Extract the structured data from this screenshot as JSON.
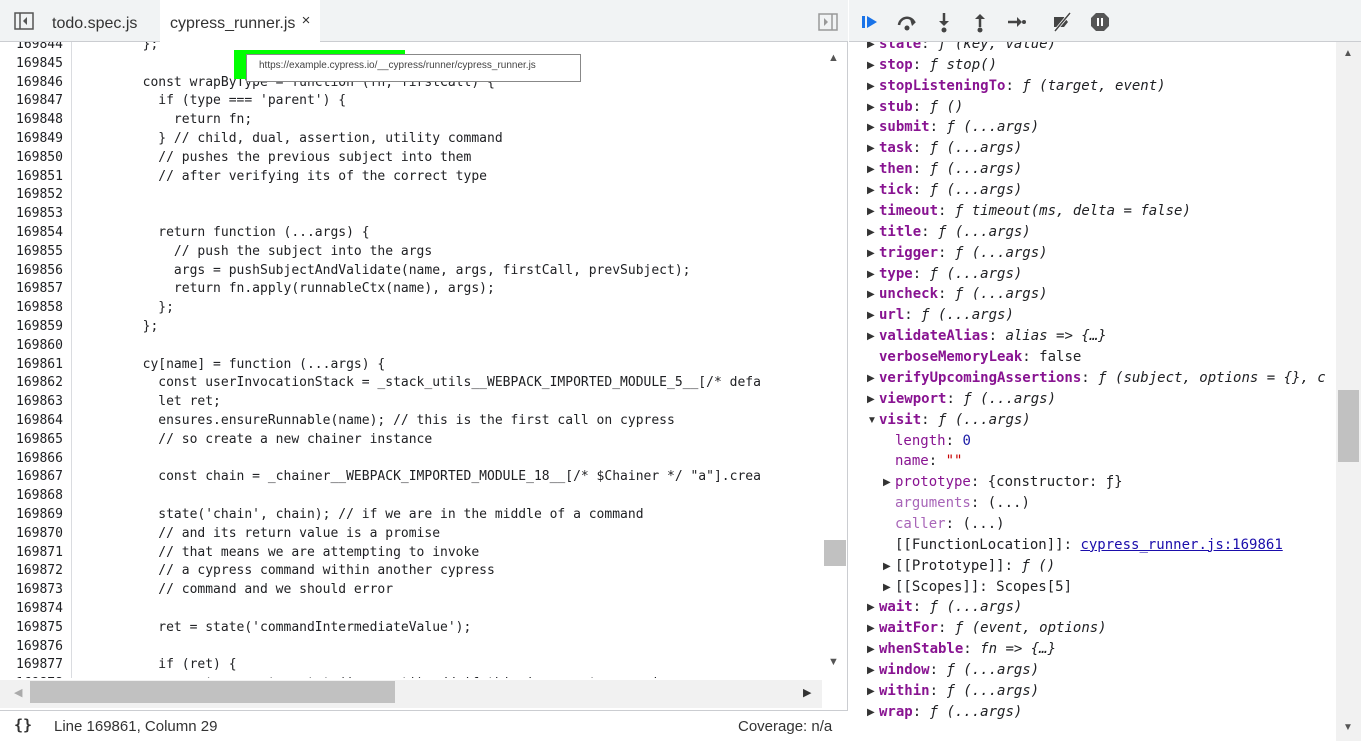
{
  "tabs": [
    {
      "label": "todo.spec.js"
    },
    {
      "label": "cypress_runner.js",
      "close": "×"
    }
  ],
  "tooltip": {
    "url": "https://example.cypress.io/__cypress/runner/cypress_runner.js"
  },
  "code_lines": [
    {
      "n": "169844",
      "t": "        };"
    },
    {
      "n": "169845",
      "t": ""
    },
    {
      "n": "169846",
      "t": "        const wrapByType = function (fn, firstCall) {"
    },
    {
      "n": "169847",
      "t": "          if (type === 'parent') {"
    },
    {
      "n": "169848",
      "t": "            return fn;"
    },
    {
      "n": "169849",
      "t": "          } // child, dual, assertion, utility command"
    },
    {
      "n": "169850",
      "t": "          // pushes the previous subject into them"
    },
    {
      "n": "169851",
      "t": "          // after verifying its of the correct type"
    },
    {
      "n": "169852",
      "t": ""
    },
    {
      "n": "169853",
      "t": ""
    },
    {
      "n": "169854",
      "t": "          return function (...args) {"
    },
    {
      "n": "169855",
      "t": "            // push the subject into the args"
    },
    {
      "n": "169856",
      "t": "            args = pushSubjectAndValidate(name, args, firstCall, prevSubject);"
    },
    {
      "n": "169857",
      "t": "            return fn.apply(runnableCtx(name), args);"
    },
    {
      "n": "169858",
      "t": "          };"
    },
    {
      "n": "169859",
      "t": "        };"
    },
    {
      "n": "169860",
      "t": ""
    },
    {
      "n": "169861",
      "t": "        cy[name] = function (...args) {"
    },
    {
      "n": "169862",
      "t": "          const userInvocationStack = _stack_utils__WEBPACK_IMPORTED_MODULE_5__[/* defa"
    },
    {
      "n": "169863",
      "t": "          let ret;"
    },
    {
      "n": "169864",
      "t": "          ensures.ensureRunnable(name); // this is the first call on cypress"
    },
    {
      "n": "169865",
      "t": "          // so create a new chainer instance"
    },
    {
      "n": "169866",
      "t": ""
    },
    {
      "n": "169867",
      "t": "          const chain = _chainer__WEBPACK_IMPORTED_MODULE_18__[/* $Chainer */ \"a\"].crea"
    },
    {
      "n": "169868",
      "t": ""
    },
    {
      "n": "169869",
      "t": "          state('chain', chain); // if we are in the middle of a command"
    },
    {
      "n": "169870",
      "t": "          // and its return value is a promise"
    },
    {
      "n": "169871",
      "t": "          // that means we are attempting to invoke"
    },
    {
      "n": "169872",
      "t": "          // a cypress command within another cypress"
    },
    {
      "n": "169873",
      "t": "          // command and we should error"
    },
    {
      "n": "169874",
      "t": ""
    },
    {
      "n": "169875",
      "t": "          ret = state('commandIntermediateValue');"
    },
    {
      "n": "169876",
      "t": ""
    },
    {
      "n": "169877",
      "t": "          if (ret) {"
    },
    {
      "n": "169878",
      "t": "            const current = state('current'); // if this is a custom promise"
    }
  ],
  "status": {
    "braces": "{}",
    "position": "Line 169861, Column 29",
    "coverage": "Coverage: n/a"
  },
  "scope": [
    {
      "arrow": "▶",
      "indent": 0,
      "key": "state",
      "colon": ":",
      "val": " ƒ (key, value)"
    },
    {
      "arrow": "▶",
      "indent": 0,
      "key": "stop",
      "colon": ":",
      "val": " ƒ stop()"
    },
    {
      "arrow": "▶",
      "indent": 0,
      "key": "stopListeningTo",
      "colon": ":",
      "val": " ƒ (target, event)"
    },
    {
      "arrow": "▶",
      "indent": 0,
      "key": "stub",
      "colon": ":",
      "val": " ƒ ()"
    },
    {
      "arrow": "▶",
      "indent": 0,
      "key": "submit",
      "colon": ":",
      "val": " ƒ (...args)"
    },
    {
      "arrow": "▶",
      "indent": 0,
      "key": "task",
      "colon": ":",
      "val": " ƒ (...args)"
    },
    {
      "arrow": "▶",
      "indent": 0,
      "key": "then",
      "colon": ":",
      "val": " ƒ (...args)"
    },
    {
      "arrow": "▶",
      "indent": 0,
      "key": "tick",
      "colon": ":",
      "val": " ƒ (...args)"
    },
    {
      "arrow": "▶",
      "indent": 0,
      "key": "timeout",
      "colon": ":",
      "val": " ƒ timeout(ms, delta = false)"
    },
    {
      "arrow": "▶",
      "indent": 0,
      "key": "title",
      "colon": ":",
      "val": " ƒ (...args)"
    },
    {
      "arrow": "▶",
      "indent": 0,
      "key": "trigger",
      "colon": ":",
      "val": " ƒ (...args)"
    },
    {
      "arrow": "▶",
      "indent": 0,
      "key": "type",
      "colon": ":",
      "val": " ƒ (...args)"
    },
    {
      "arrow": "▶",
      "indent": 0,
      "key": "uncheck",
      "colon": ":",
      "val": " ƒ (...args)"
    },
    {
      "arrow": "▶",
      "indent": 0,
      "key": "url",
      "colon": ":",
      "val": " ƒ (...args)"
    },
    {
      "arrow": "▶",
      "indent": 0,
      "key": "validateAlias",
      "colon": ":",
      "val": " alias => {…}"
    },
    {
      "arrow": "",
      "indent": 0,
      "key": "verboseMemoryLeak",
      "colon": ":",
      "val": " false"
    },
    {
      "arrow": "▶",
      "indent": 0,
      "key": "verifyUpcomingAssertions",
      "colon": ":",
      "val": " ƒ (subject, options = {}, c"
    },
    {
      "arrow": "▶",
      "indent": 0,
      "key": "viewport",
      "colon": ":",
      "val": " ƒ (...args)"
    },
    {
      "arrow": "▼",
      "indent": 0,
      "key": "visit",
      "colon": ":",
      "val": " ƒ (...args)"
    },
    {
      "arrow": "",
      "indent": 1,
      "key": "length",
      "colon": ":",
      "val": " 0",
      "valtype": "num",
      "keytype": "plain"
    },
    {
      "arrow": "",
      "indent": 1,
      "key": "name",
      "colon": ":",
      "val": " \"\"",
      "valtype": "str",
      "keytype": "plain"
    },
    {
      "arrow": "▶",
      "indent": 1,
      "key": "prototype",
      "colon": ":",
      "val": " {constructor: ƒ}",
      "keytype": "plain"
    },
    {
      "arrow": "",
      "indent": 1,
      "key": "arguments",
      "colon": ":",
      "val": " (...)",
      "keytype": "dim"
    },
    {
      "arrow": "",
      "indent": 1,
      "key": "caller",
      "colon": ":",
      "val": " (...)",
      "keytype": "dim"
    },
    {
      "arrow": "",
      "indent": 1,
      "key": "[[FunctionLocation]]",
      "colon": ":",
      "val": "cypress_runner.js:169861",
      "valtype": "link",
      "keytype": "internal"
    },
    {
      "arrow": "▶",
      "indent": 1,
      "key": "[[Prototype]]",
      "colon": ":",
      "val": " ƒ ()",
      "keytype": "internal"
    },
    {
      "arrow": "▶",
      "indent": 1,
      "key": "[[Scopes]]",
      "colon": ":",
      "val": " Scopes[5]",
      "keytype": "internal"
    },
    {
      "arrow": "▶",
      "indent": 0,
      "key": "wait",
      "colon": ":",
      "val": " ƒ (...args)"
    },
    {
      "arrow": "▶",
      "indent": 0,
      "key": "waitFor",
      "colon": ":",
      "val": " ƒ (event, options)"
    },
    {
      "arrow": "▶",
      "indent": 0,
      "key": "whenStable",
      "colon": ":",
      "val": " fn => {…}"
    },
    {
      "arrow": "▶",
      "indent": 0,
      "key": "window",
      "colon": ":",
      "val": " ƒ (...args)"
    },
    {
      "arrow": "▶",
      "indent": 0,
      "key": "within",
      "colon": ":",
      "val": " ƒ (...args)"
    },
    {
      "arrow": "▶",
      "indent": 0,
      "key": "wrap",
      "colon": ":",
      "val": " ƒ (...args)"
    }
  ],
  "icons": {
    "nav": "sidebar-toggle-icon",
    "resume": "resume-icon",
    "step_over": "step-over-icon",
    "step_into": "step-into-icon",
    "step_out": "step-out-icon",
    "step": "step-icon",
    "deactivate": "deactivate-breakpoints-icon",
    "pause_exceptions": "pause-on-exceptions-icon"
  },
  "colors": {
    "accent": "#1a73e8",
    "keyword": "#881391"
  }
}
